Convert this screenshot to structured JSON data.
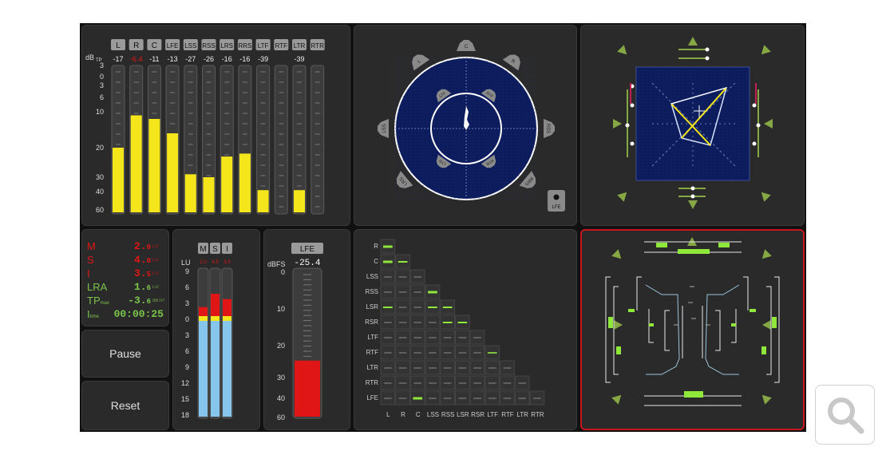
{
  "colors": {
    "yellow": "#f5e61b",
    "red": "#e01616",
    "green_text": "#7ac44a",
    "lightblue": "#86c5ec",
    "lime": "#8fe83a",
    "olive": "#86a844",
    "circle_bg": "#0d1c5c",
    "white": "#ffffff"
  },
  "channel_meters": {
    "unit_label": "dB",
    "unit_sub": "TP",
    "channels": [
      "L",
      "R",
      "C",
      "LFE",
      "LSS",
      "RSS",
      "LRS",
      "RRS",
      "LTF",
      "RTF",
      "LTR",
      "RTR"
    ],
    "peaks": [
      "-17",
      "-6.4",
      "-11",
      "-13",
      "-27",
      "-26",
      "-16",
      "-16",
      "-39",
      "",
      "-39",
      ""
    ],
    "peak_red": [
      false,
      true,
      false,
      false,
      false,
      false,
      false,
      false,
      false,
      false,
      false,
      false
    ],
    "levels_db": [
      -20,
      -11,
      -12,
      -16,
      -29,
      -30,
      -23,
      -22,
      -39,
      -60,
      -39,
      -60
    ],
    "scale": [
      "3",
      "0",
      "3",
      "6",
      "10",
      "20",
      "30",
      "40",
      "60"
    ]
  },
  "surround_scope": {
    "speakers_outer": [
      "L",
      "C",
      "R",
      "LSS",
      "RSS",
      "LRS",
      "RRS"
    ],
    "speakers_inner": [
      "LTF",
      "RTF",
      "LTR",
      "RTR"
    ],
    "lfe_label": "LFE"
  },
  "loudness": {
    "rows": [
      {
        "label": "M",
        "value": "2.",
        "dec": "0",
        "unit": "LU",
        "color": "red"
      },
      {
        "label": "S",
        "value": "4.",
        "dec": "0",
        "unit": "LU",
        "color": "red"
      },
      {
        "label": "I",
        "value": "3.",
        "dec": "5",
        "unit": "LU",
        "color": "red"
      },
      {
        "label": "LRA",
        "value": "1.",
        "dec": "6",
        "unit": "LU",
        "color": "green"
      },
      {
        "label": "TP",
        "sub": "max",
        "value": "-3.",
        "dec": "6",
        "unit": "dBTP",
        "color": "green"
      }
    ],
    "time_label": "I",
    "time_sub": "time",
    "time_value": "00:00:25"
  },
  "buttons": {
    "pause": "Pause",
    "reset": "Reset"
  },
  "msi_meter": {
    "labels": [
      "M",
      "S",
      "I"
    ],
    "peaks": [
      "2.0",
      "4.5",
      "3.5"
    ],
    "unit": "LU",
    "scale": [
      "9",
      "6",
      "3",
      "0",
      "3",
      "6",
      "9",
      "12",
      "15",
      "18"
    ],
    "values_lu": [
      2.0,
      4.5,
      3.5
    ]
  },
  "lfe_meter": {
    "label": "LFE",
    "unit": "dBFS",
    "value": "-25.4",
    "level_dbfs": -25.4,
    "scale": [
      "0",
      "10",
      "20",
      "30",
      "40",
      "60"
    ]
  },
  "correlation": {
    "labels": [
      "R",
      "C",
      "LSS",
      "RSS",
      "LSR",
      "RSR",
      "LTF",
      "RTF",
      "LTR",
      "RTR",
      "LFE"
    ],
    "x_labels": [
      "L",
      "R",
      "C",
      "LSS",
      "RSS",
      "LSR",
      "RSR",
      "LTF",
      "RTF",
      "LTR",
      "RTR"
    ]
  },
  "zoom_icon": "magnifier-icon"
}
